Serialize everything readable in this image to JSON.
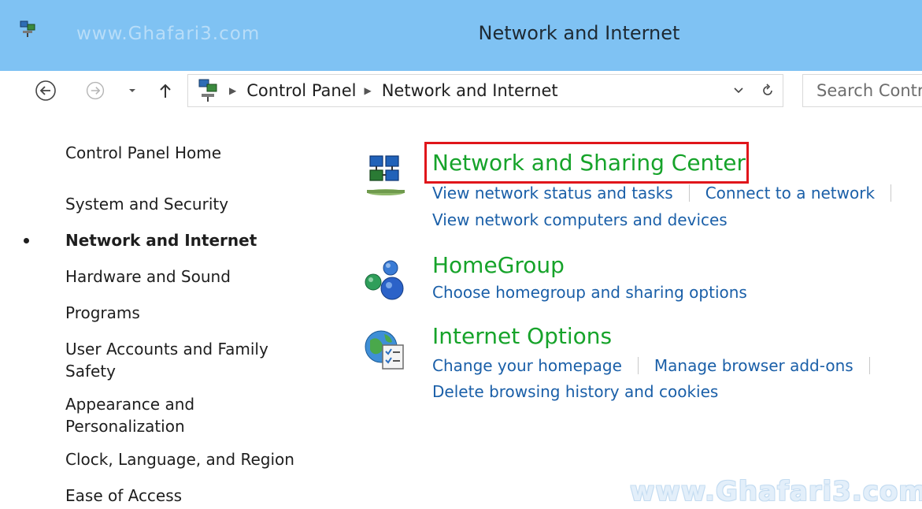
{
  "window": {
    "title": "Network and Internet",
    "watermark": "www.Ghafari3.com"
  },
  "nav": {
    "breadcrumb": [
      "Control Panel",
      "Network and Internet"
    ],
    "search_placeholder": "Search Control Panel"
  },
  "sidebar": {
    "items": [
      {
        "label": "Control Panel Home"
      },
      {
        "label": "System and Security"
      },
      {
        "label": "Network and Internet",
        "active": true
      },
      {
        "label": "Hardware and Sound"
      },
      {
        "label": "Programs"
      },
      {
        "label": "User Accounts and Family Safety"
      },
      {
        "label": "Appearance and Personalization"
      },
      {
        "label": "Clock, Language, and Region"
      },
      {
        "label": "Ease of Access"
      }
    ],
    "user_accounts_line1": "User Accounts and Family",
    "user_accounts_line2": "Safety",
    "appearance_line1": "Appearance and",
    "appearance_line2": "Personalization"
  },
  "sections": [
    {
      "title": "Network and Sharing Center",
      "icon": "network-sharing-center-icon",
      "links": [
        "View network status and tasks",
        "Connect to a network",
        "View network computers and devices"
      ]
    },
    {
      "title": "HomeGroup",
      "icon": "homegroup-icon",
      "links": [
        "Choose homegroup and sharing options"
      ]
    },
    {
      "title": "Internet Options",
      "icon": "internet-options-icon",
      "links": [
        "Change your homepage",
        "Manage browser add-ons",
        "Delete browsing history and cookies"
      ]
    }
  ],
  "colors": {
    "titlebar": "#7fc2f3",
    "section_title": "#16a32a",
    "link": "#1a5fa8",
    "highlight": "#e0161b"
  },
  "footer_watermark": "www.Ghafari3.com"
}
